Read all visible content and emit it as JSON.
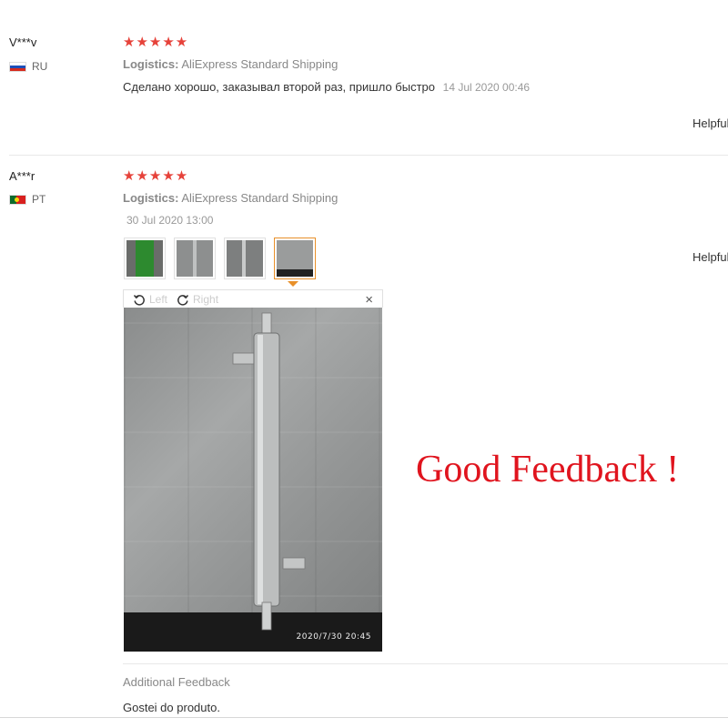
{
  "reviews": [
    {
      "user": "V***v",
      "country": "RU",
      "stars": "★★★★★",
      "logistics_label": "Logistics:",
      "logistics_value": "AliExpress Standard Shipping",
      "text": "Сделано хорошо, заказывал второй раз, пришло быстро",
      "date": "14 Jul 2020 00:46",
      "helpful": "Helpful"
    },
    {
      "user": "A***r",
      "country": "PT",
      "stars": "★★★★★",
      "logistics_label": "Logistics:",
      "logistics_value": "AliExpress Standard Shipping",
      "date": "30 Jul 2020 13:00",
      "helpful": "Helpful",
      "viewer": {
        "left_label": "Left",
        "right_label": "Right",
        "close": "×",
        "timestamp": "2020/7/30  20:45"
      },
      "additional_feedback_label": "Additional Feedback",
      "additional_feedback_text": "Gostei do produto."
    }
  ],
  "overlay_text": "Good Feedback !",
  "colors": {
    "star": "#e6423a",
    "overlay": "#e0141e",
    "active_thumb": "#e8902a"
  }
}
